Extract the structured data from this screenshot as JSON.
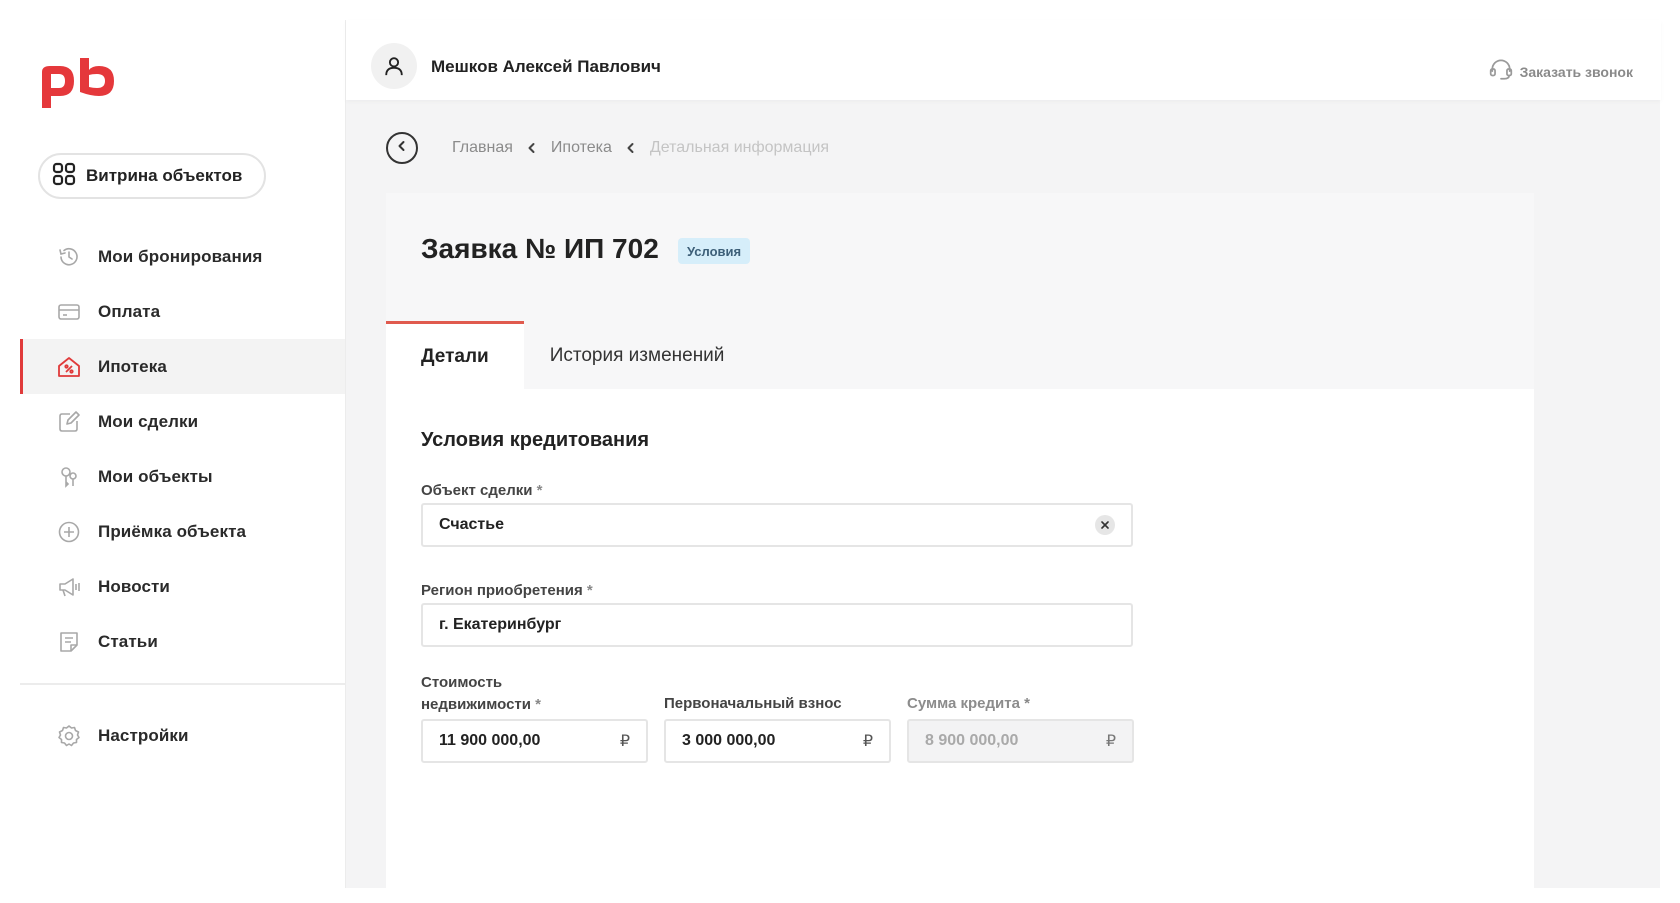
{
  "sidebar": {
    "logo_text": "pb",
    "showcase_label": "Витрина объектов",
    "items": [
      {
        "label": "Мои бронирования",
        "icon": "history-icon"
      },
      {
        "label": "Оплата",
        "icon": "card-icon"
      },
      {
        "label": "Ипотека",
        "icon": "mortgage-house-icon",
        "active": true
      },
      {
        "label": "Мои сделки",
        "icon": "edit-icon"
      },
      {
        "label": "Мои объекты",
        "icon": "keys-icon"
      },
      {
        "label": "Приёмка объекта",
        "icon": "plus-circle-icon"
      },
      {
        "label": "Новости",
        "icon": "megaphone-icon"
      },
      {
        "label": "Статьи",
        "icon": "article-icon"
      }
    ],
    "settings_label": "Настройки"
  },
  "header": {
    "user_name": "Мешков Алексей Павлович",
    "callback_label": "Заказать звонок"
  },
  "breadcrumbs": [
    "Главная",
    "Ипотека",
    "Детальная информация"
  ],
  "application": {
    "title": "Заявка № ИП 702",
    "status": "Условия",
    "tabs": [
      "Детали",
      "История изменений"
    ]
  },
  "form": {
    "section_title": "Условия кредитования",
    "object_label": "Объект сделки",
    "object_value": "Счастье",
    "region_label": "Регион приобретения",
    "region_value": "г. Екатеринбург",
    "cost_label_1": "Стоимость",
    "cost_label_2": "недвижимости",
    "cost_value": "11 900 000,00",
    "down_label": "Первоначальный взнос",
    "down_value": "3 000 000,00",
    "loan_label": "Сумма кредита",
    "loan_value": "8 900 000,00",
    "required_mark": "*",
    "currency": "₽"
  },
  "colors": {
    "accent": "#e03a3a",
    "brand_logo": "#e5383b",
    "badge_bg": "#d6eefa"
  }
}
